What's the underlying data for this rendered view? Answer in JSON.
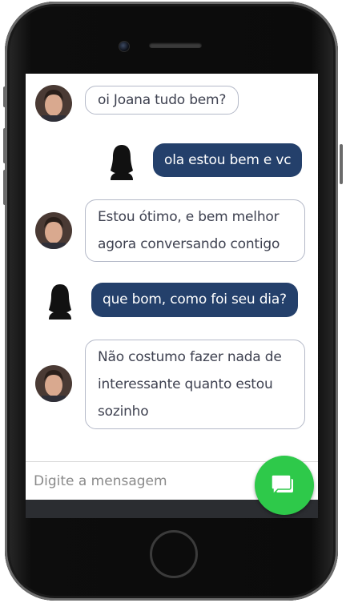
{
  "conversation": {
    "messages": [
      {
        "from": "contact",
        "lines": [
          "oi Joana tudo bem?"
        ]
      },
      {
        "from": "user",
        "lines": [
          "ola estou bem e vc"
        ]
      },
      {
        "from": "contact",
        "lines": [
          "Estou ótimo, e bem melhor",
          "agora conversando contigo"
        ]
      },
      {
        "from": "user",
        "lines": [
          "que bom, como foi seu dia?"
        ]
      },
      {
        "from": "contact",
        "lines": [
          "Não costumo fazer nada de",
          "interessante quanto estou",
          "sozinho"
        ]
      }
    ]
  },
  "composer": {
    "placeholder": "Digite a mensagem",
    "send_icon": "chat-bubble-icon"
  },
  "colors": {
    "user_bubble": "#24406b",
    "contact_bubble_border": "#b4b9c8",
    "send_button": "#2ec94a"
  }
}
